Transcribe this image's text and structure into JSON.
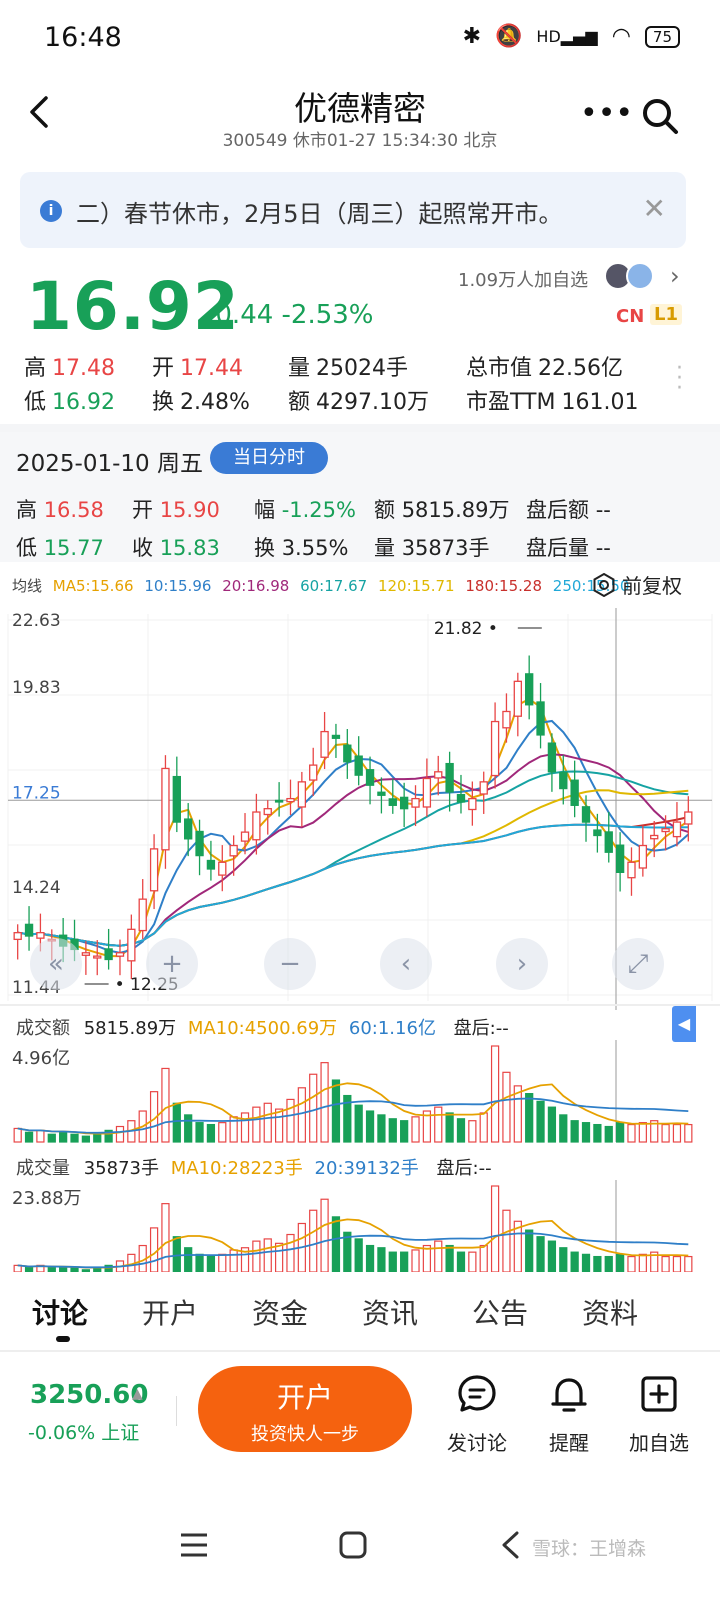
{
  "status_bar": {
    "time": "16:48",
    "battery": "75",
    "network": "HD"
  },
  "header": {
    "title": "优德精密",
    "subtitle": "300549 休市01-27 15:34:30 北京"
  },
  "notice": {
    "text": "二）春节休市，2月5日（周三）起照常开市。"
  },
  "quote": {
    "price": "16.92",
    "change": "-0.44 -2.53%",
    "followers": "1.09万人加自选",
    "badge_cn": "CN",
    "badge_l1": "L1",
    "stats": {
      "high_label": "高",
      "high": "17.48",
      "open_label": "开",
      "open": "17.44",
      "volume_label": "量",
      "volume": "25024手",
      "mcap_label": "总市值",
      "mcap": "22.56亿",
      "low_label": "低",
      "low": "16.92",
      "turnover_label": "换",
      "turnover": "2.48%",
      "amount_label": "额",
      "amount": "4297.10万",
      "pe_label": "市盈TTM",
      "pe": "161.01"
    }
  },
  "day_info": {
    "date": "2025-01-10 周五",
    "tag": "当日分时",
    "high_label": "高",
    "high": "16.58",
    "open_label": "开",
    "open": "15.90",
    "amp_label": "幅",
    "amp": "-1.25%",
    "amount_label": "额",
    "amount": "5815.89万",
    "after_amount_label": "盘后额",
    "after_amount": "--",
    "low_label": "低",
    "low": "15.77",
    "close_label": "收",
    "close": "15.83",
    "turnover_label": "换",
    "turnover": "3.55%",
    "volume_label": "量",
    "volume": "35873手",
    "after_volume_label": "盘后量",
    "after_volume": "--"
  },
  "ma_legend": {
    "title": "均线",
    "items": [
      {
        "label": "MA5:15.66",
        "color": "#e6a100"
      },
      {
        "label": "10:15.96",
        "color": "#2f7fc8"
      },
      {
        "label": "20:16.98",
        "color": "#a0287a"
      },
      {
        "label": "60:17.67",
        "color": "#16a3a3"
      },
      {
        "label": "120:15.71",
        "color": "#e0b800"
      },
      {
        "label": "180:15.28",
        "color": "#c8302c"
      },
      {
        "label": "250:15.50",
        "color": "#20a8d8"
      }
    ],
    "adjust": "前复权"
  },
  "chart_data": {
    "type": "candlestick",
    "y_ticks": [
      "22.63",
      "19.83",
      "17.25",
      "14.24",
      "11.44"
    ],
    "ylim": [
      11.44,
      22.63
    ],
    "current_line": "17.25",
    "max_label": "21.82",
    "min_label": "12.25",
    "closes": [
      13.3,
      13.2,
      13.3,
      13.1,
      12.9,
      12.8,
      12.7,
      12.6,
      12.5,
      12.7,
      13.4,
      14.3,
      15.8,
      18.2,
      16.6,
      16.1,
      15.6,
      15.2,
      15.4,
      15.9,
      16.3,
      16.9,
      17.0,
      17.2,
      17.3,
      17.8,
      18.3,
      19.3,
      19.1,
      18.4,
      18.0,
      17.7,
      17.4,
      17.1,
      17.0,
      17.3,
      17.9,
      18.1,
      17.5,
      17.2,
      17.3,
      17.8,
      19.6,
      19.9,
      20.8,
      20.1,
      19.2,
      18.1,
      17.6,
      17.1,
      16.6,
      16.2,
      15.7,
      15.1,
      15.4,
      15.9,
      16.2,
      16.4,
      16.6,
      16.9
    ],
    "colors": {
      "up": "#e84545",
      "down": "#18a058"
    }
  },
  "panels": {
    "amount": {
      "title": "成交额",
      "value": "5815.89万",
      "ma10": "MA10:4500.69万",
      "ma60": "60:1.16亿",
      "after": "盘后:--",
      "max": "4.96亿",
      "values": [
        0.7,
        0.5,
        0.6,
        0.4,
        0.5,
        0.4,
        0.3,
        0.4,
        0.6,
        0.8,
        1.1,
        1.6,
        2.6,
        3.8,
        2.0,
        1.4,
        1.0,
        0.9,
        1.0,
        1.3,
        1.5,
        1.8,
        2.0,
        1.7,
        2.2,
        2.8,
        3.5,
        4.1,
        3.2,
        2.4,
        1.9,
        1.6,
        1.4,
        1.2,
        1.1,
        1.3,
        1.6,
        1.8,
        1.5,
        1.2,
        1.1,
        1.5,
        4.96,
        3.6,
        2.9,
        2.5,
        2.1,
        1.8,
        1.4,
        1.1,
        1.0,
        0.9,
        0.8,
        1.0,
        0.9,
        1.0,
        1.1,
        0.9,
        0.9,
        0.9
      ]
    },
    "volume": {
      "title": "成交量",
      "value": "35873手",
      "ma10": "MA10:28223手",
      "ma20": "20:39132手",
      "after": "盘后:--",
      "max": "23.88万",
      "values": [
        0.3,
        0.2,
        0.3,
        0.2,
        0.2,
        0.2,
        0.1,
        0.2,
        0.3,
        0.5,
        0.8,
        1.2,
        2.0,
        3.1,
        1.6,
        1.1,
        0.8,
        0.7,
        0.8,
        1.0,
        1.1,
        1.4,
        1.5,
        1.3,
        1.7,
        2.2,
        2.8,
        3.3,
        2.5,
        1.8,
        1.5,
        1.2,
        1.1,
        0.9,
        0.9,
        1.0,
        1.2,
        1.4,
        1.2,
        0.9,
        0.9,
        1.2,
        3.9,
        2.8,
        2.3,
        1.9,
        1.6,
        1.4,
        1.1,
        0.9,
        0.8,
        0.7,
        0.7,
        0.8,
        0.7,
        0.8,
        0.9,
        0.7,
        0.7,
        0.7
      ]
    }
  },
  "tabs": [
    "讨论",
    "开户",
    "资金",
    "资讯",
    "公告",
    "资料"
  ],
  "bottom": {
    "index_price": "3250.60",
    "index_change": "-0.06% 上证",
    "open_label": "开户",
    "open_sub": "投资快人一步",
    "post_label": "发讨论",
    "alert_label": "提醒",
    "watch_label": "加自选"
  },
  "watermark": "雪球：王增森"
}
